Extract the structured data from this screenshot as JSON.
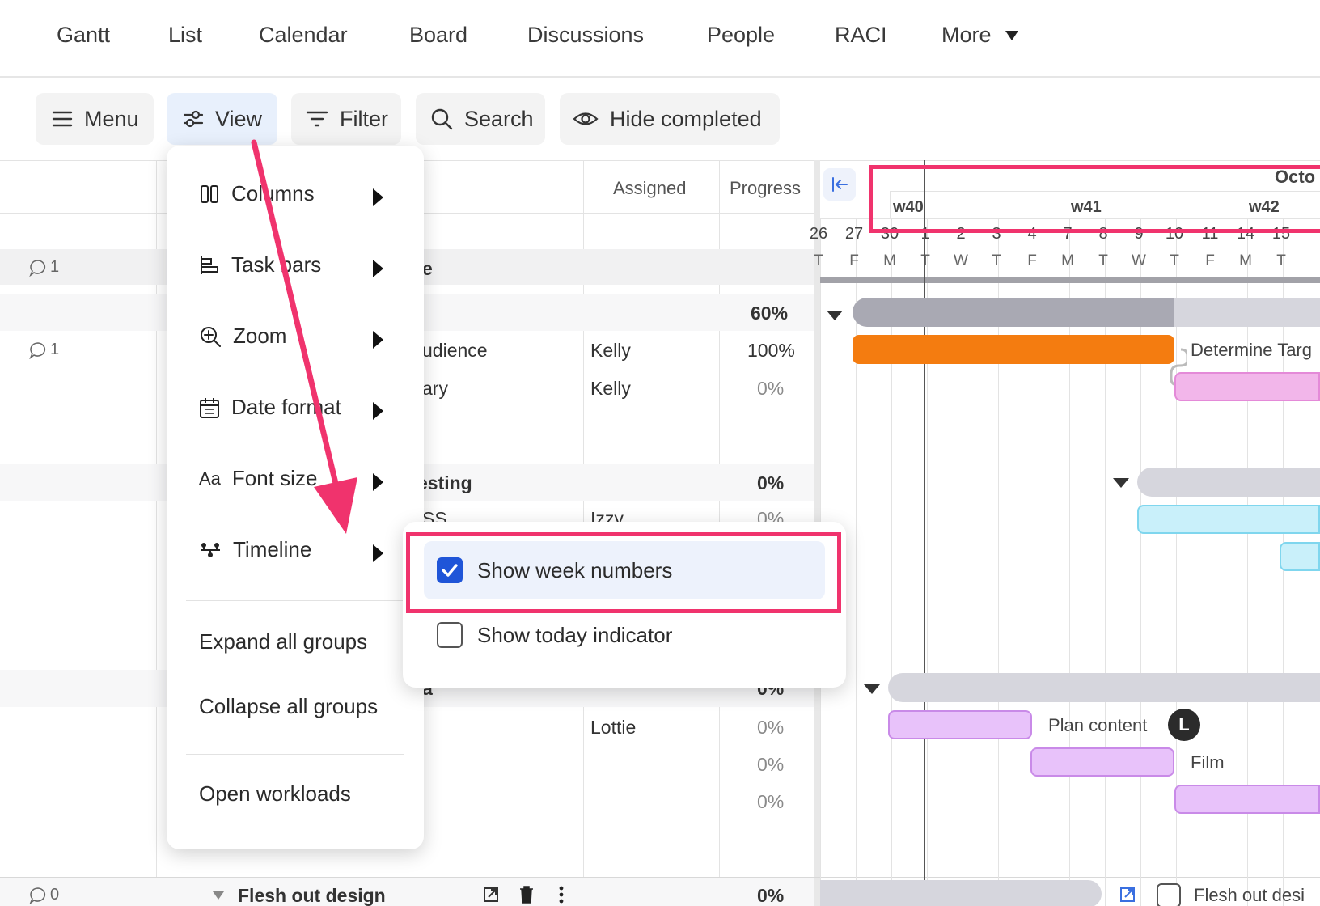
{
  "nav": {
    "tabs": [
      "Gantt",
      "List",
      "Calendar",
      "Board",
      "Discussions",
      "People",
      "RACI"
    ],
    "more_label": "More"
  },
  "toolbar": {
    "menu_label": "Menu",
    "view_label": "View",
    "filter_label": "Filter",
    "search_label": "Search",
    "hide_completed_label": "Hide completed"
  },
  "table": {
    "col_assigned": "Assigned",
    "col_progress": "Progress",
    "rows": [
      {
        "comment": "1",
        "name_fragment": "e",
        "assigned": "",
        "progress": ""
      },
      {
        "comment": "",
        "name_fragment": "",
        "assigned": "",
        "progress": "60%"
      },
      {
        "comment": "1",
        "name_fragment": "udience",
        "assigned": "Kelly",
        "progress": "100%"
      },
      {
        "comment": "",
        "name_fragment": "ary",
        "assigned": "Kelly",
        "progress": "0%"
      },
      {
        "comment": "",
        "name_fragment": "esting",
        "assigned": "",
        "progress": "0%"
      },
      {
        "comment": "",
        "name_fragment": "SS",
        "assigned": "Izzy",
        "progress": "0%"
      },
      {
        "comment": "",
        "name_fragment": "a",
        "assigned": "",
        "progress": "0%"
      },
      {
        "comment": "",
        "name_fragment": "",
        "assigned": "Lottie",
        "progress": "0%"
      },
      {
        "comment": "",
        "name_fragment": "",
        "assigned": "",
        "progress": "0%"
      },
      {
        "comment": "",
        "name_fragment": "",
        "assigned": "",
        "progress": "0%"
      }
    ],
    "footer_row": {
      "comment": "0",
      "name": "Flesh out design",
      "progress": "0%"
    }
  },
  "timeline": {
    "month_label": "Octo",
    "weeks": [
      "w40",
      "w41",
      "w42"
    ],
    "days": [
      "26",
      "27",
      "30",
      "1",
      "2",
      "3",
      "4",
      "7",
      "8",
      "9",
      "10",
      "11",
      "14",
      "15"
    ],
    "weekdays": [
      "T",
      "F",
      "M",
      "T",
      "W",
      "T",
      "F",
      "M",
      "T",
      "W",
      "T",
      "F",
      "M",
      "T"
    ],
    "labels": {
      "determine": "Determine Targ",
      "plan_content": "Plan content",
      "plan_avatar": "L",
      "film": "Film",
      "footer_task": "Flesh out desi"
    },
    "colors": {
      "summary_dark": "#a9a9b3",
      "summary_light": "#d6d6dd",
      "orange": "#f47c10",
      "pink": "#f2b6ea",
      "cyan": "#c9f0fa",
      "violet": "#e8c2fa"
    }
  },
  "view_menu": {
    "items": [
      "Columns",
      "Task bars",
      "Zoom",
      "Date format",
      "Font size",
      "Timeline"
    ],
    "actions": [
      "Expand all groups",
      "Collapse all groups"
    ],
    "workloads": "Open workloads"
  },
  "timeline_submenu": {
    "show_week_numbers": "Show week numbers",
    "show_week_numbers_checked": true,
    "show_today_indicator": "Show today indicator",
    "show_today_indicator_checked": false
  },
  "annotation_color": "#f0336d"
}
